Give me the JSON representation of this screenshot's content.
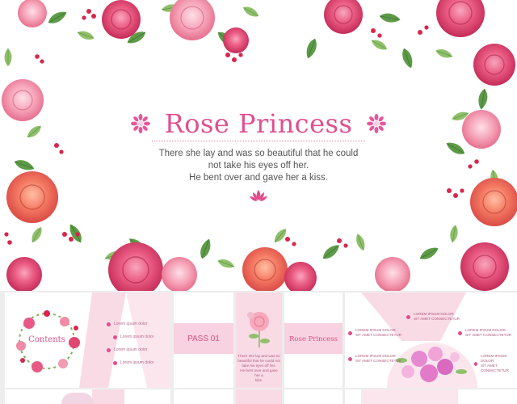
{
  "hero": {
    "title": "Rose Princess",
    "subtitle_lines": [
      "There she lay and was so beautiful that he could",
      "not take his eyes off her.",
      "He bent over and gave her a kiss."
    ],
    "icons": [
      "daisy-icon",
      "lotus-icon",
      "rose-icon",
      "leaf-icon",
      "berry-icon"
    ]
  },
  "thumbnails": {
    "contents": {
      "title": "Contents",
      "items": [
        "Lorem ipsum dolor",
        "Lorem ipsum dolor",
        "Lorem ipsum dolor",
        "Lorem ipsum dolor"
      ]
    },
    "pass": {
      "label": "PASS 01"
    },
    "rose": {
      "caption_lines": [
        "There she lay and was so",
        "beautiful that he could not",
        "take his eyes off her.",
        "He bent over and gave her a",
        "kiss."
      ]
    },
    "princess": {
      "label": "Rose Princess"
    },
    "floral": {
      "labels": [
        [
          "LOREM IPSUM DOLOR",
          "SIT AMET CONSECTETUR"
        ],
        [
          "LOREM IPSUM DOLOR",
          "SIT AMET CONSECTETUR"
        ],
        [
          "LOREM IPSUM DOLOR",
          "SIT AMET CONSECTETUR"
        ],
        [
          "LOREM IPSUM DOLOR",
          "SIT AMET CONSECTETUR"
        ],
        [
          "LOREM IPSUM DOLOR",
          "SIT AMET CONSECTETUR"
        ]
      ]
    }
  },
  "colors": {
    "accent": "#e04f8f",
    "pink_panel": "#f8d2e1",
    "strip_bg": "#ededed"
  }
}
